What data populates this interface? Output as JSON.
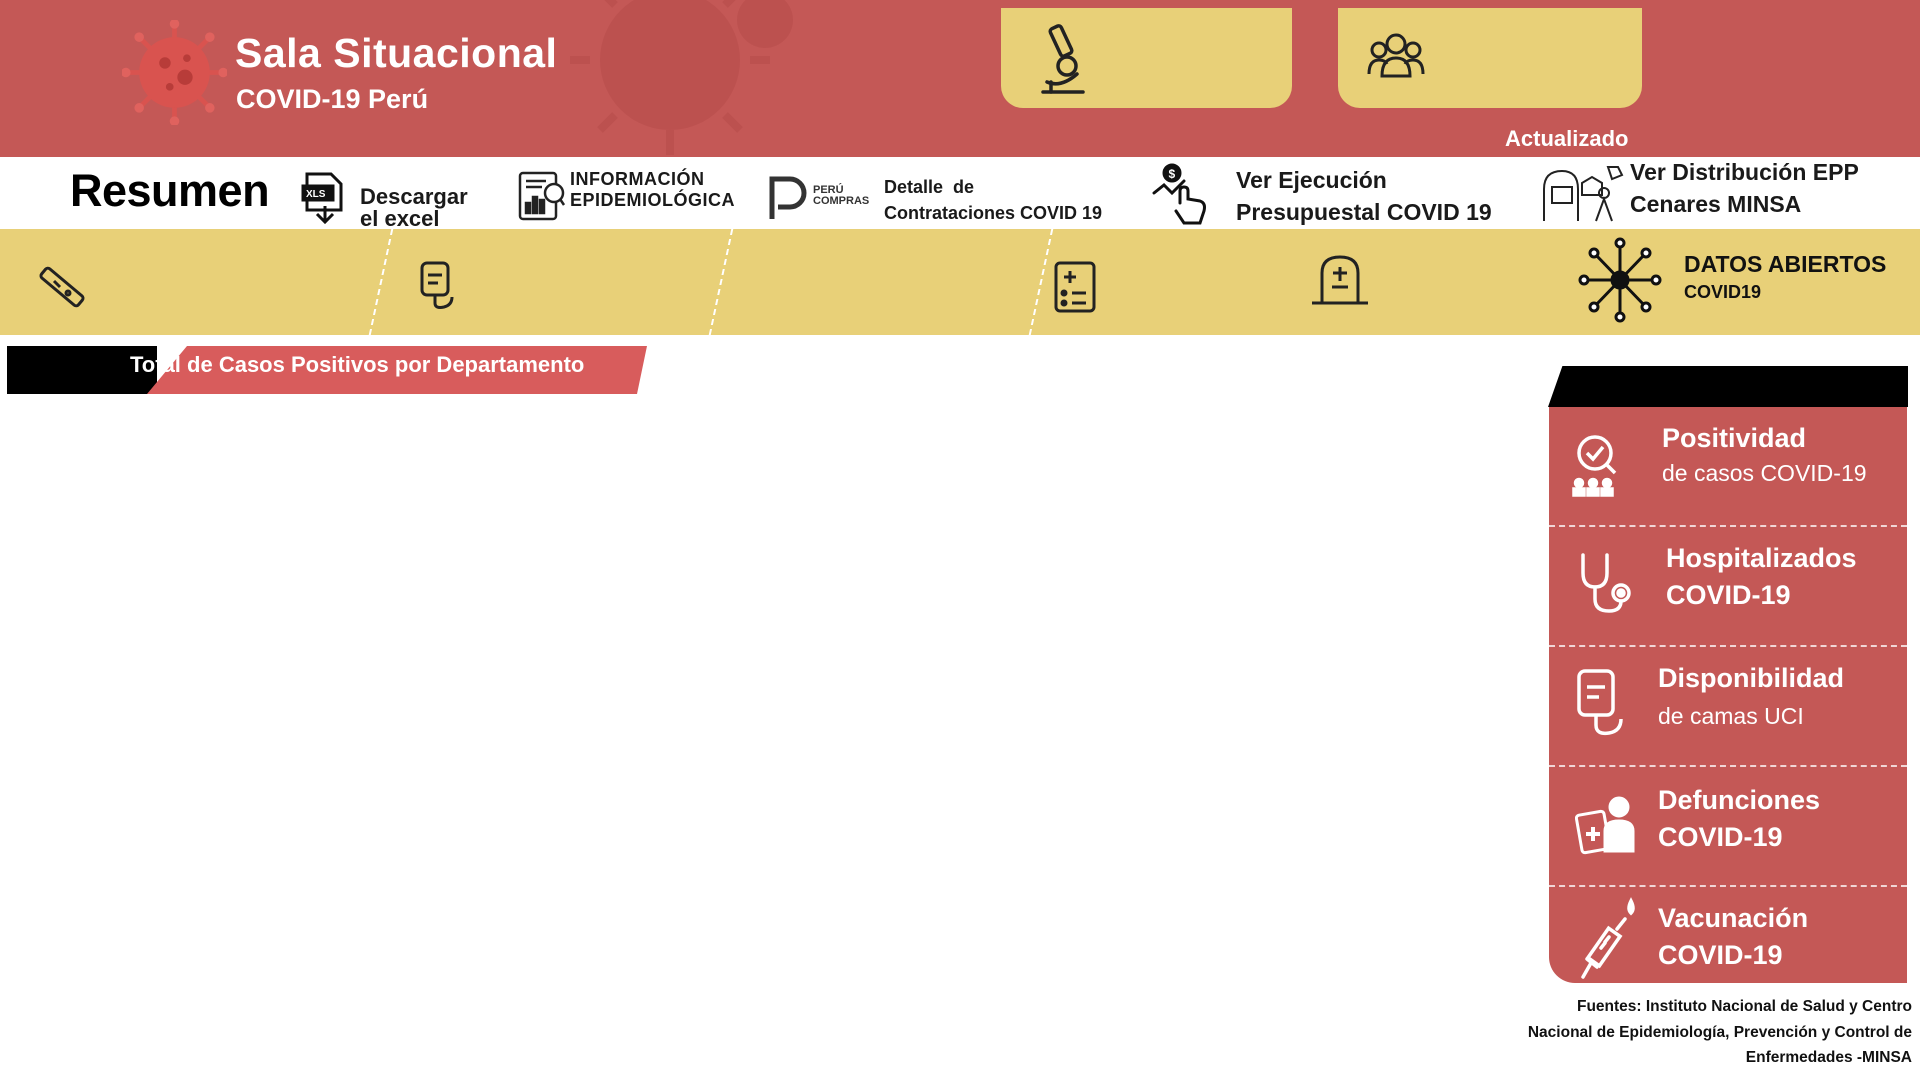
{
  "header": {
    "title": "Sala Situacional",
    "subtitle": "COVID-19 Perú",
    "updated_label": "Actualizado"
  },
  "menu": {
    "resumen_label": "Resumen",
    "items": [
      {
        "line1": "Descargar",
        "line2": "el excel"
      },
      {
        "line1": "INFORMACIÓN",
        "line2": "EPIDEMIOLÓGICA"
      },
      {
        "badge1": "PERÚ",
        "badge2": "COMPRAS",
        "line1": "Detalle  de",
        "line2": "Contrataciones COVID 19"
      },
      {
        "line1": "Ver Ejecución",
        "line2": "Presupuestal COVID 19"
      },
      {
        "line1": "Ver Distribución EPP",
        "line2": "Cenares MINSA"
      }
    ]
  },
  "strip": {
    "datos_title": "DATOS ABIERTOS",
    "datos_sub": "COVID19"
  },
  "section": {
    "title": "Total de Casos Positivos por Departamento"
  },
  "panel": {
    "items": [
      {
        "title": "Positividad",
        "sub": "de casos COVID-19"
      },
      {
        "title": "Hospitalizados",
        "sub": "COVID-19"
      },
      {
        "title": "Disponibilidad",
        "sub": "de camas UCI"
      },
      {
        "title": "Defunciones",
        "sub": "COVID-19"
      },
      {
        "title": "Vacunación",
        "sub": "COVID-19"
      }
    ]
  },
  "footer": {
    "line1": "Fuentes: Instituto Nacional de Salud y Centro",
    "line2": "Nacional de Epidemiología, Prevención y Control de",
    "line3": "Enfermedades -MINSA"
  },
  "colors": {
    "header_red": "#c45856",
    "accent_yellow": "#e8d078",
    "panel_red": "#c45856",
    "black": "#000000"
  }
}
